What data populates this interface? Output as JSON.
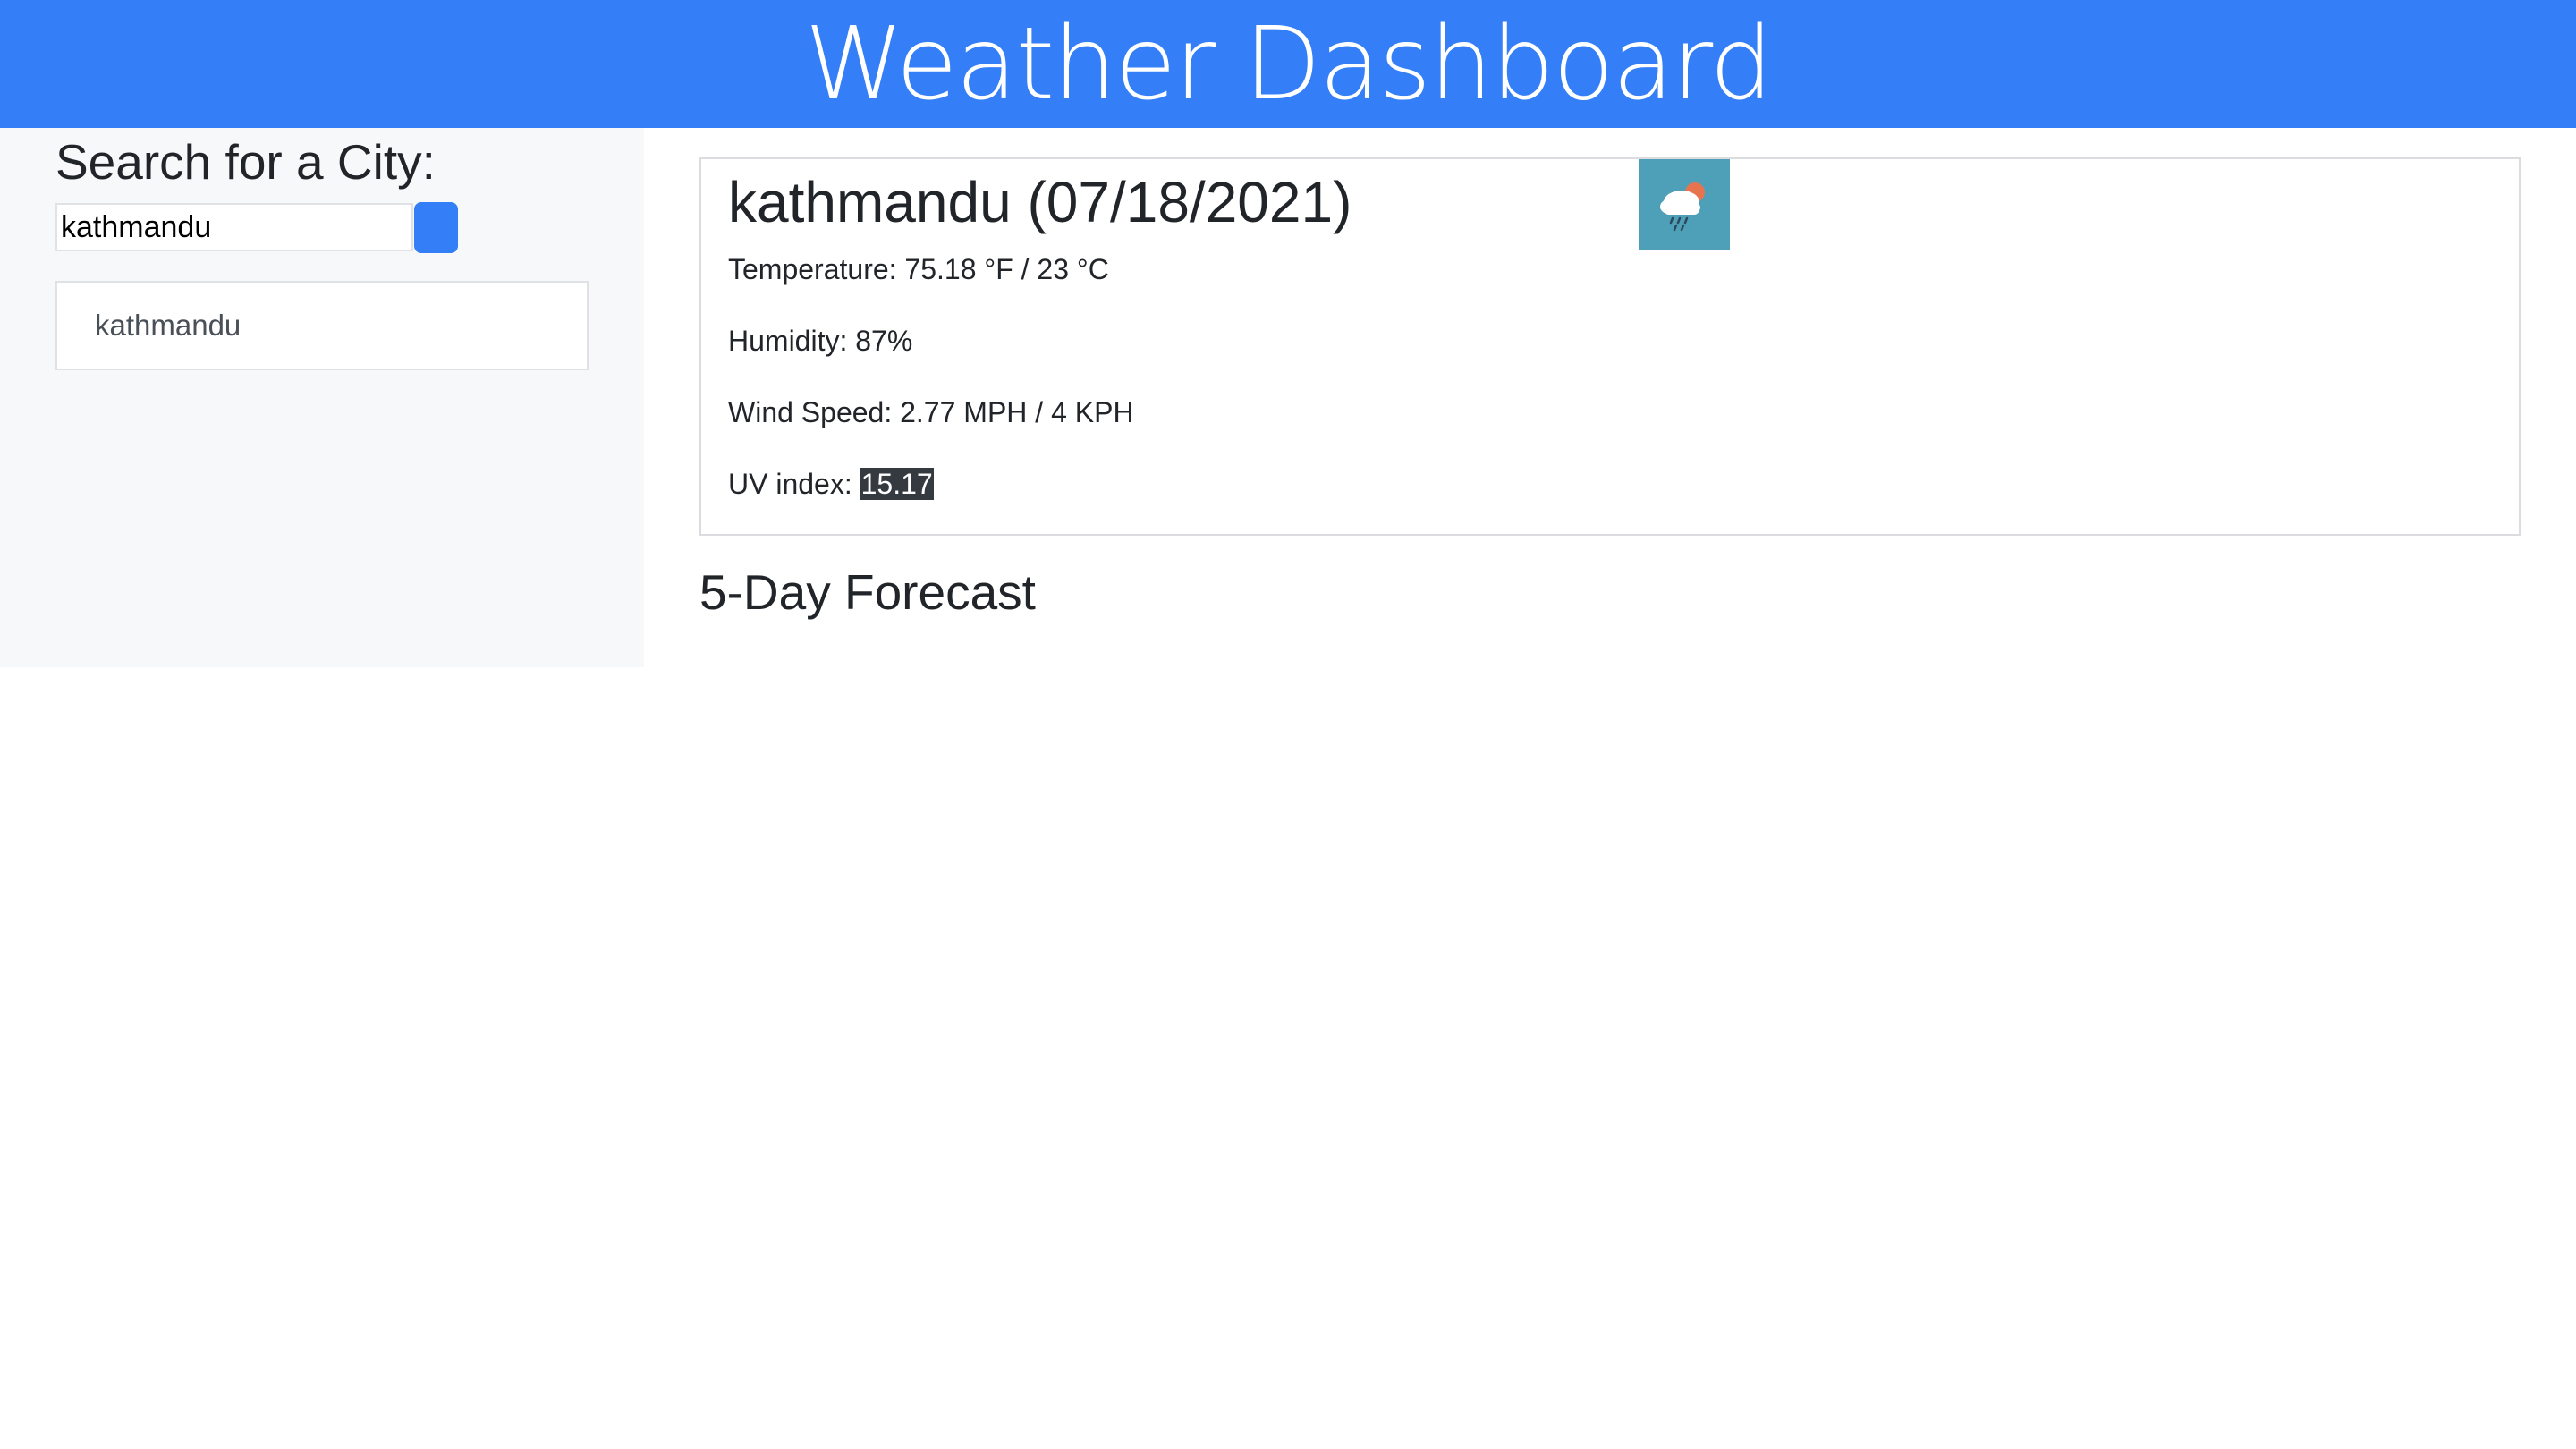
{
  "header": {
    "title": "Weather Dashboard"
  },
  "sidebar": {
    "heading": "Search for a City:",
    "search_value": "kathmandu",
    "search_button_icon": "search-icon",
    "history": [
      "kathmandu"
    ]
  },
  "current": {
    "title": "kathmandu (07/18/2021)",
    "icon": "rain-cloud-sun-icon",
    "temperature": "Temperature: 75.18 °F / 23 °C",
    "humidity": "Humidity: 87%",
    "wind": "Wind Speed: 2.77 MPH / 4 KPH",
    "uv_label": "UV index: ",
    "uv_value": "15.17"
  },
  "forecast": {
    "heading": "5-Day Forecast"
  },
  "colors": {
    "accent": "#347ef7",
    "sidebar_bg": "#f7f8f9",
    "icon_bg": "#4ea0b8",
    "uv_badge": "#343a40"
  }
}
